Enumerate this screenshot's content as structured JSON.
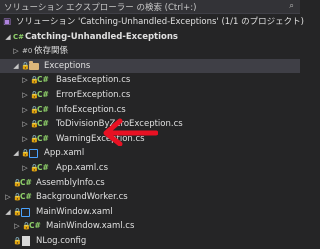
{
  "search": {
    "text": "ソリューション エクスプローラー の検索 (Ctrl+:)",
    "icon": "search-icon"
  },
  "solution": {
    "label": "ソリューション 'Catching-Unhandled-Exceptions' (1/1 のプロジェクト)"
  },
  "project": {
    "label": "Catching-Unhandled-Exceptions"
  },
  "dependencies": {
    "label": "依存関係"
  },
  "exceptions_folder": {
    "label": "Exceptions"
  },
  "exception_files": [
    {
      "label": "BaseException.cs"
    },
    {
      "label": "ErrorException.cs"
    },
    {
      "label": "InfoException.cs"
    },
    {
      "label": "ToDivisionByZeroException.cs"
    },
    {
      "label": "WarningException.cs"
    }
  ],
  "app_xaml": {
    "label": "App.xaml"
  },
  "app_xaml_cs": {
    "label": "App.xaml.cs"
  },
  "assembly_info": {
    "label": "AssemblyInfo.cs"
  },
  "background_worker": {
    "label": "BackgroundWorker.cs"
  },
  "main_window": {
    "label": "MainWindow.xaml"
  },
  "main_window_cs": {
    "label": "MainWindow.xaml.cs"
  },
  "nlog_config": {
    "label": "NLog.config"
  },
  "icons": {
    "csharp": "C#",
    "dependencies": "#0"
  },
  "colors": {
    "background": "#252526",
    "selection": "#3f3f46",
    "annotation_arrow": "#e81123",
    "csharp_icon": "#8fd16a",
    "folder": "#dcb67a"
  }
}
